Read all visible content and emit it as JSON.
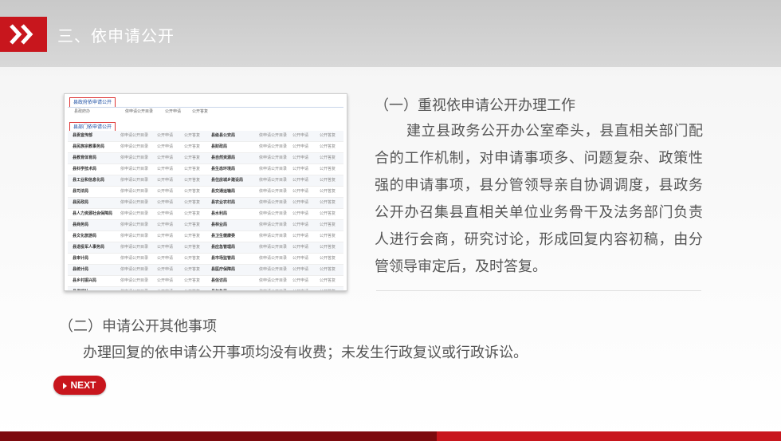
{
  "header": {
    "title": "三、依申请公开"
  },
  "screenshot_panel": {
    "section1_label": "县政府依申请公开",
    "top_row": {
      "dept": "县政府办",
      "c1": "依申请公开目录",
      "c2": "公开申请",
      "c3": "公开答复"
    },
    "section2_label": "县部门依申请公开",
    "rows": [
      [
        "县委宣传部",
        "县级县公安局",
        "依申请公开目录",
        "公开申请",
        "公开答复"
      ],
      [
        "县民族宗教事务局",
        "县财政局",
        "依申请公开目录",
        "公开申请",
        "公开答复"
      ],
      [
        "县教育体育局",
        "县自然资源局",
        "依申请公开目录",
        "公开申请",
        "公开答复"
      ],
      [
        "县科学技术局",
        "县生态环境局",
        "依申请公开目录",
        "公开申请",
        "公开答复"
      ],
      [
        "县工业和信息化局",
        "县住房城乡建设局",
        "依申请公开目录",
        "公开申请",
        "公开答复"
      ],
      [
        "县司法局",
        "县交通运输局",
        "依申请公开目录",
        "公开申请",
        "公开答复"
      ],
      [
        "县民政局",
        "县农业农村局",
        "依申请公开目录",
        "公开申请",
        "公开答复"
      ],
      [
        "县人力资源社会保障局",
        "县水利局",
        "依申请公开目录",
        "公开申请",
        "公开答复"
      ],
      [
        "县商务局",
        "县林业局",
        "依申请公开目录",
        "公开申请",
        "公开答复"
      ],
      [
        "县文化旅游局",
        "县卫生健康委",
        "依申请公开目录",
        "公开申请",
        "公开答复"
      ],
      [
        "县退役军人事务局",
        "县应急管理局",
        "依申请公开目录",
        "公开申请",
        "公开答复"
      ],
      [
        "县审计局",
        "县市场监管局",
        "依申请公开目录",
        "公开申请",
        "公开答复"
      ],
      [
        "县统计局",
        "县医疗保障局",
        "依申请公开目录",
        "公开申请",
        "公开答复"
      ],
      [
        "县乡村振兴局",
        "县信访局",
        "依申请公开目录",
        "公开申请",
        "公开答复"
      ],
      [
        "县供销社",
        "县气象局",
        "依申请公开目录",
        "公开申请",
        "公开答复"
      ]
    ]
  },
  "section1": {
    "title": "（一）重视依申请公开办理工作",
    "body": "建立县政务公开办公室牵头，县直相关部门配合的工作机制，对申请事项多、问题复杂、政策性强的申请事项，县分管领导亲自协调调度，县政务公开办召集县直相关单位业务骨干及法务部门负责人进行会商，研究讨论，形成回复内容初稿，由分管领导审定后，及时答复。"
  },
  "section2": {
    "title": "（二）申请公开其他事项",
    "body": "办理回复的依申请公开事项均没有收费；未发生行政复议或行政诉讼。"
  },
  "next_button": {
    "label": "NEXT"
  },
  "colors": {
    "accent": "#c8161d",
    "dark_accent": "#7d0a0e",
    "text": "#555555"
  },
  "icons": {
    "header": "double-chevron-right-icon",
    "next": "play-triangle-icon"
  }
}
